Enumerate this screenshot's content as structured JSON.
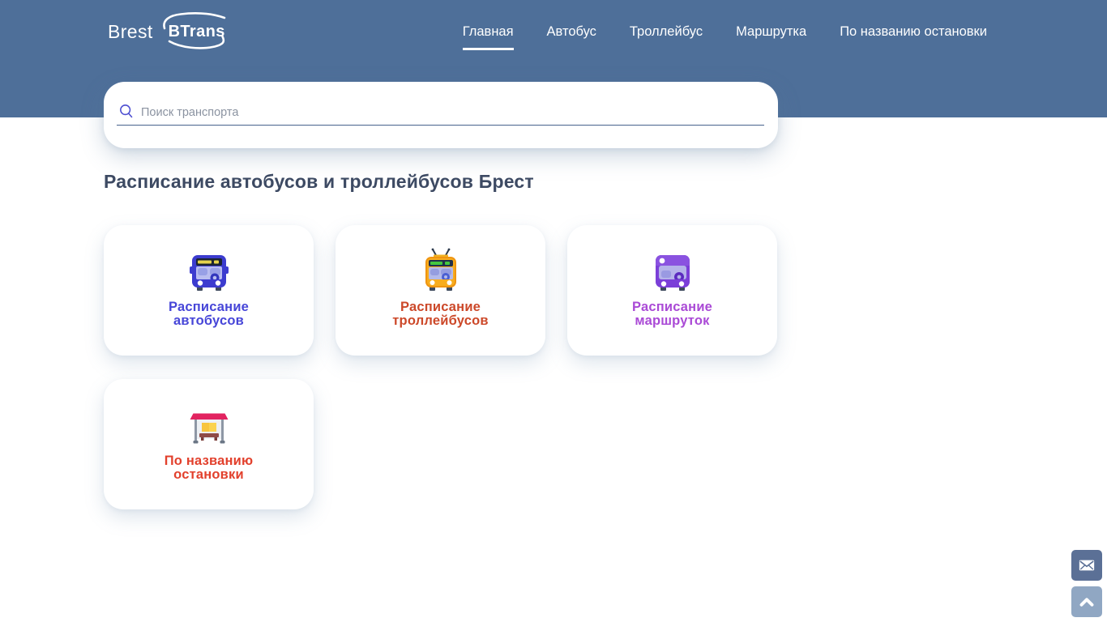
{
  "header": {
    "brand": {
      "prefix": "Brest",
      "name": "BTrans"
    },
    "nav": [
      {
        "label": "Главная",
        "active": true
      },
      {
        "label": "Автобус",
        "active": false
      },
      {
        "label": "Троллейбус",
        "active": false
      },
      {
        "label": "Маршрутка",
        "active": false
      },
      {
        "label": "По названию остановки",
        "active": false
      }
    ]
  },
  "search": {
    "placeholder": "Поиск транспорта",
    "value": "",
    "icon": "search-icon"
  },
  "main": {
    "heading": "Расписание автобусов и троллейбусов Брест",
    "cards": [
      {
        "icon": "bus-icon",
        "lines": [
          "Расписание",
          "автобусов"
        ],
        "color": "#4746d8"
      },
      {
        "icon": "trolleybus-icon",
        "lines": [
          "Расписание",
          "троллейбусов"
        ],
        "color": "#cc4829"
      },
      {
        "icon": "minibus-icon",
        "lines": [
          "Расписание",
          "маршруток"
        ],
        "color": "#aa4ad6"
      },
      {
        "icon": "bus-stop-icon",
        "lines": [
          "По названию",
          "остановки"
        ],
        "color": "#e2402c"
      }
    ]
  },
  "floating_buttons": {
    "email": {
      "icon": "email-icon"
    },
    "scroll_top": {
      "icon": "chevron-up-icon"
    }
  },
  "colors": {
    "header_bg": "#4e6f99",
    "search_underline": "#47638d",
    "search_icon": "#4d4ed1",
    "heading_text": "#3d4a63",
    "email_button_bg": "#5b7096",
    "scroll_top_button_bg": "#90a7c3"
  }
}
